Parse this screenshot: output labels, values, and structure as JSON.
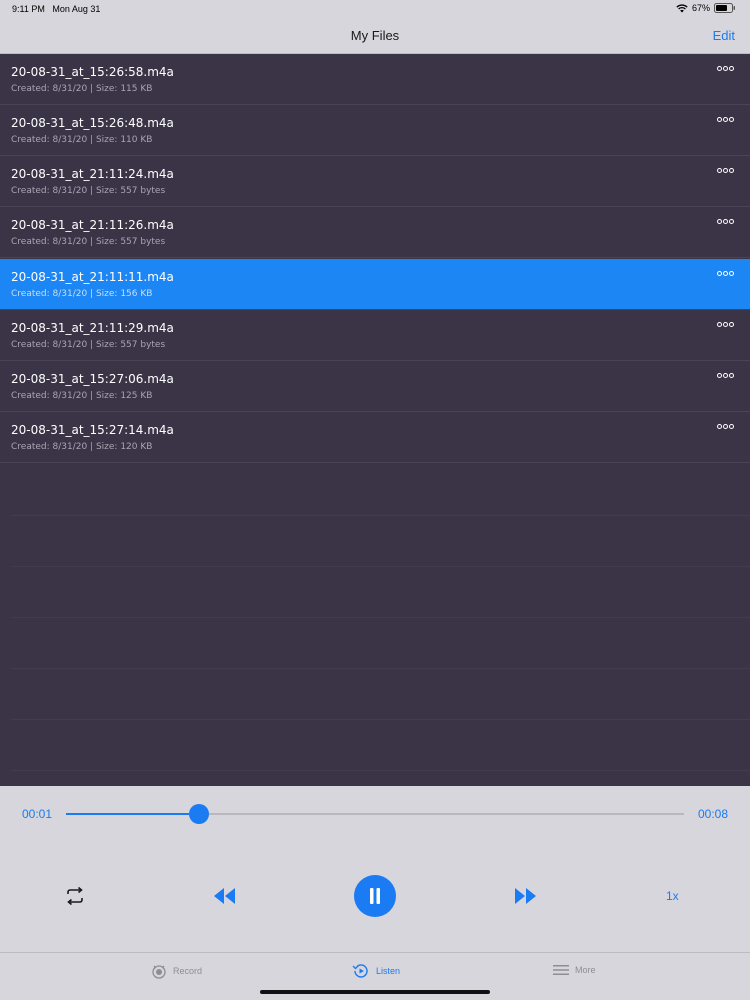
{
  "status_bar": {
    "time": "9:11 PM",
    "date": "Mon Aug 31",
    "battery": "67%"
  },
  "nav": {
    "title": "My Files",
    "edit_label": "Edit"
  },
  "files": [
    {
      "name": "20-08-31_at_15:26:58.m4a",
      "meta": "Created: 8/31/20 | Size: 115 KB",
      "selected": false
    },
    {
      "name": "20-08-31_at_15:26:48.m4a",
      "meta": "Created: 8/31/20 | Size: 110 KB",
      "selected": false
    },
    {
      "name": "20-08-31_at_21:11:24.m4a",
      "meta": "Created: 8/31/20 | Size: 557 bytes",
      "selected": false
    },
    {
      "name": "20-08-31_at_21:11:26.m4a",
      "meta": "Created: 8/31/20 | Size: 557 bytes",
      "selected": false
    },
    {
      "name": "20-08-31_at_21:11:11.m4a",
      "meta": "Created: 8/31/20 | Size: 156 KB",
      "selected": true
    },
    {
      "name": "20-08-31_at_21:11:29.m4a",
      "meta": "Created: 8/31/20 | Size: 557 bytes",
      "selected": false
    },
    {
      "name": "20-08-31_at_15:27:06.m4a",
      "meta": "Created: 8/31/20 | Size: 125 KB",
      "selected": false
    },
    {
      "name": "20-08-31_at_15:27:14.m4a",
      "meta": "Created: 8/31/20 | Size: 120 KB",
      "selected": false
    }
  ],
  "player": {
    "current_time": "00:01",
    "duration": "00:08",
    "progress": 0.215,
    "speed_label": "1x",
    "state": "playing"
  },
  "tabs": [
    {
      "label": "Record",
      "icon": "record-icon",
      "active": false
    },
    {
      "label": "Listen",
      "icon": "listen-icon",
      "active": true
    },
    {
      "label": "More",
      "icon": "menu-icon",
      "active": false
    }
  ],
  "colors": {
    "accent": "#1a7bf2",
    "list_background": "#3b3447",
    "selected_row": "#1c86f5",
    "chrome": "#d7d6dc"
  }
}
